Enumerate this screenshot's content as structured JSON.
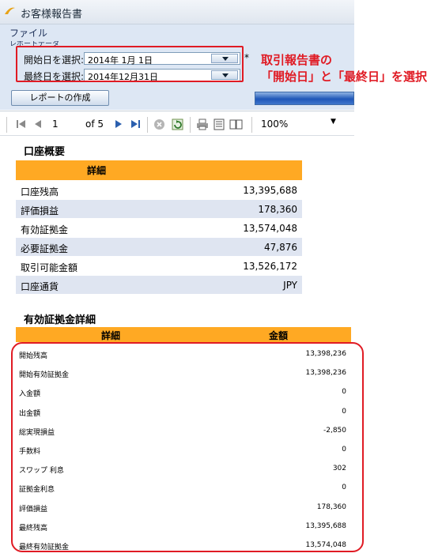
{
  "window": {
    "title": "お客様報告書"
  },
  "menu": {
    "file": "ファイル",
    "group_label": "レポートデータ"
  },
  "params": {
    "start_label": "開始日を選択:",
    "start_value": "2014年  1月  1日",
    "end_label": "最終日を選択:",
    "end_value": "2014年12月31日",
    "required_mark": "*"
  },
  "callout": {
    "line1": "取引報告書の",
    "line2": "「開始日」と「最終日」を選択"
  },
  "create_button": "レポートの作成",
  "progress": {
    "fraction": 1.0
  },
  "toolbar": {
    "page": "1",
    "of_label": "of 5",
    "zoom": "100%"
  },
  "account_summary": {
    "title": "口座概要",
    "header": "詳細",
    "rows": [
      {
        "label": "口座残高",
        "value": "13,395,688"
      },
      {
        "label": "評価損益",
        "value": "178,360"
      },
      {
        "label": "有効証拠金",
        "value": "13,574,048"
      },
      {
        "label": "必要証拠金",
        "value": "47,876"
      },
      {
        "label": "取引可能金額",
        "value": "13,526,172"
      },
      {
        "label": "口座通貨",
        "value": "JPY"
      }
    ]
  },
  "margin_detail": {
    "title": "有効証拠金詳細",
    "header_detail": "詳細",
    "header_amount": "金額",
    "rows": [
      {
        "label": "開始残高",
        "value": "13,398,236"
      },
      {
        "label": "開始有効証拠金",
        "value": "13,398,236"
      },
      {
        "label": "入金額",
        "value": "0"
      },
      {
        "label": "出金額",
        "value": "0"
      },
      {
        "label": "総実現損益",
        "value": "-2,850"
      },
      {
        "label": "手数料",
        "value": "0"
      },
      {
        "label": "スワップ 利息",
        "value": "302"
      },
      {
        "label": "証拠金利息",
        "value": "0"
      },
      {
        "label": "評価損益",
        "value": "178,360"
      },
      {
        "label": "最終残高",
        "value": "13,395,688"
      },
      {
        "label": "最終有効証拠金",
        "value": "13,574,048"
      }
    ]
  },
  "colors": {
    "accent_orange": "#ffa923",
    "highlight_red": "#e01b24",
    "row_alt": "#dfe5f1"
  }
}
